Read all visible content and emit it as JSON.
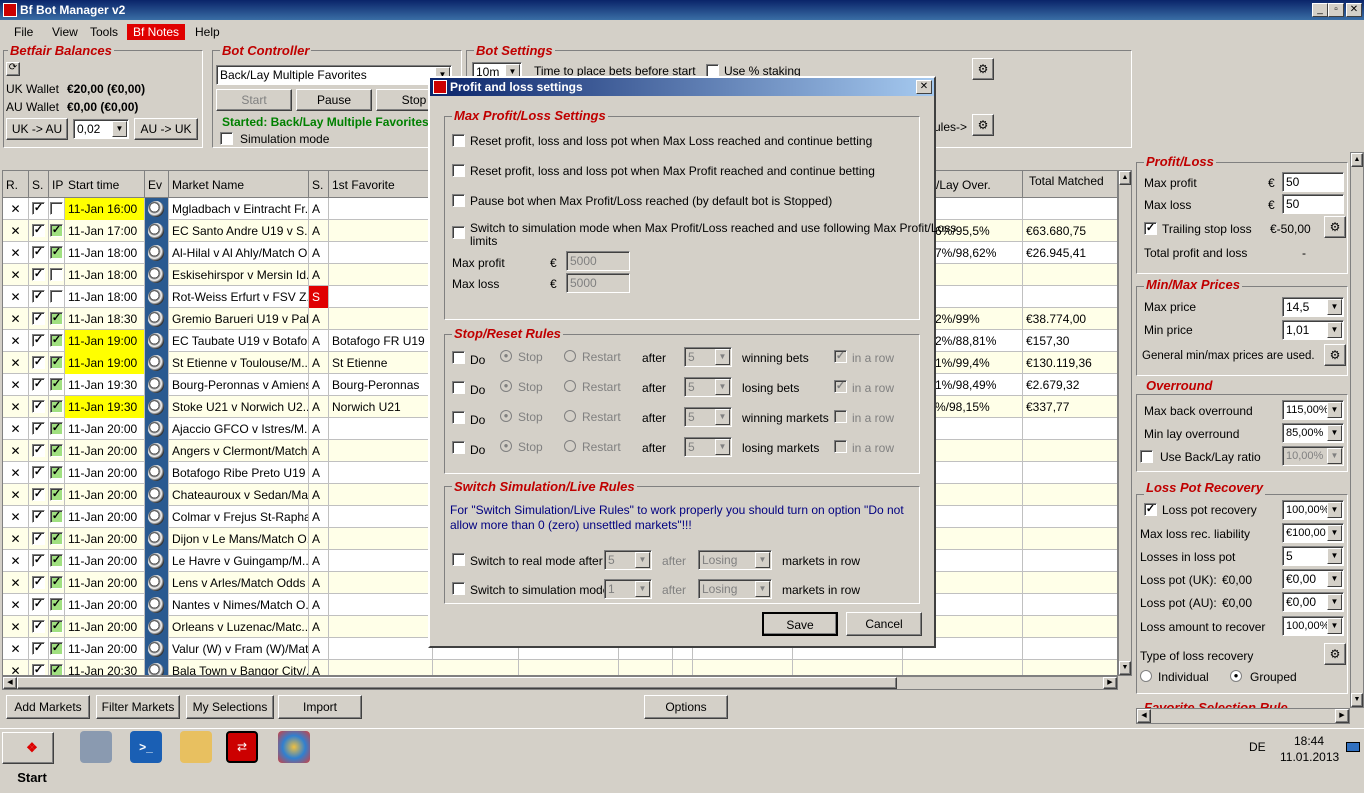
{
  "window": {
    "title": "Bf Bot Manager v2",
    "buttons": [
      "_",
      "▫",
      "✕"
    ]
  },
  "menu": [
    "File",
    "View",
    "Tools",
    "Bf Notes",
    "Help"
  ],
  "balances": {
    "title": "Betfair Balances",
    "uk_label": "UK Wallet",
    "uk_value": "€20,00 (€0,00)",
    "au_label": "AU Wallet",
    "au_value": "€0,00 (€0,00)",
    "uk_to_au": "UK -> AU",
    "amount": "0,02",
    "au_to_uk": "AU -> UK"
  },
  "controller": {
    "title": "Bot Controller",
    "strategy": "Back/Lay Multiple Favorites",
    "start": "Start",
    "pause": "Pause",
    "stop": "Stop",
    "status": "Started: Back/Lay Multiple Favorites",
    "sim_mode": "Simulation mode"
  },
  "settings": {
    "title": "Bot Settings",
    "time_value": "10m",
    "time_label": "Time to place bets before start",
    "use_staking": "Use % staking",
    "rules_label": "ules->"
  },
  "grid": {
    "headers": [
      "R.",
      "S.",
      "IP",
      "Start time",
      "Ev",
      "Market Name",
      "S.",
      "1st Favorite",
      "/Lay Over.",
      "Total Matched"
    ],
    "rows": [
      {
        "time": "11-Jan 16:00",
        "name": "Mgladbach v Eintracht Fr...",
        "s": "A",
        "fav": "",
        "over": "",
        "matched": "",
        "yellow": true,
        "red": false,
        "ip": false
      },
      {
        "time": "11-Jan 17:00",
        "name": "EC Santo Andre U19 v S...",
        "s": "A",
        "fav": "",
        "over": "6%/95,5%",
        "matched": "€63.680,75",
        "yellow": false,
        "red": false,
        "ip": true
      },
      {
        "time": "11-Jan 18:00",
        "name": "Al-Hilal v Al Ahly/Match O...",
        "s": "A",
        "fav": "",
        "over": "7%/98,62%",
        "matched": "€26.945,41",
        "yellow": false,
        "red": false,
        "ip": true
      },
      {
        "time": "11-Jan 18:00",
        "name": "Eskisehirspor v Mersin Id...",
        "s": "A",
        "fav": "",
        "over": "",
        "matched": "",
        "yellow": false,
        "red": false,
        "ip": false
      },
      {
        "time": "11-Jan 18:00",
        "name": "Rot-Weiss Erfurt v FSV Z...",
        "s": "S",
        "fav": "",
        "over": "",
        "matched": "",
        "yellow": false,
        "red": true,
        "ip": false
      },
      {
        "time": "11-Jan 18:30",
        "name": "Gremio Barueri U19 v Pal...",
        "s": "A",
        "fav": "",
        "over": "2%/99%",
        "matched": "€38.774,00",
        "yellow": false,
        "red": false,
        "ip": true
      },
      {
        "time": "11-Jan 19:00",
        "name": "EC Taubate U19 v Botafo...",
        "s": "A",
        "fav": "Botafogo FR U19",
        "over": "2%/88,81%",
        "matched": "€157,30",
        "yellow": true,
        "red": false,
        "ip": true
      },
      {
        "time": "11-Jan 19:00",
        "name": "St Etienne v Toulouse/M...",
        "s": "A",
        "fav": "St Etienne",
        "over": "1%/99,4%",
        "matched": "€130.119,36",
        "yellow": true,
        "red": false,
        "ip": true
      },
      {
        "time": "11-Jan 19:30",
        "name": "Bourg-Peronnas v Amiens...",
        "s": "A",
        "fav": "Bourg-Peronnas",
        "over": "1%/98,49%",
        "matched": "€2.679,32",
        "yellow": false,
        "red": false,
        "ip": true
      },
      {
        "time": "11-Jan 19:30",
        "name": "Stoke U21 v Norwich U2...",
        "s": "A",
        "fav": "Norwich U21",
        "over": "%/98,15%",
        "matched": "€337,77",
        "yellow": true,
        "red": false,
        "ip": true
      },
      {
        "time": "11-Jan 20:00",
        "name": "Ajaccio GFCO v Istres/M...",
        "s": "A",
        "fav": "",
        "over": "",
        "matched": "",
        "yellow": false,
        "red": false,
        "ip": true
      },
      {
        "time": "11-Jan 20:00",
        "name": "Angers v Clermont/Match...",
        "s": "A",
        "fav": "",
        "over": "",
        "matched": "",
        "yellow": false,
        "red": false,
        "ip": true
      },
      {
        "time": "11-Jan 20:00",
        "name": "Botafogo Ribe Preto U19 ...",
        "s": "A",
        "fav": "",
        "over": "",
        "matched": "",
        "yellow": false,
        "red": false,
        "ip": true
      },
      {
        "time": "11-Jan 20:00",
        "name": "Chateauroux v Sedan/Ma...",
        "s": "A",
        "fav": "",
        "over": "",
        "matched": "",
        "yellow": false,
        "red": false,
        "ip": true
      },
      {
        "time": "11-Jan 20:00",
        "name": "Colmar v Frejus St-Rapha...",
        "s": "A",
        "fav": "",
        "over": "",
        "matched": "",
        "yellow": false,
        "red": false,
        "ip": true
      },
      {
        "time": "11-Jan 20:00",
        "name": "Dijon v Le Mans/Match O...",
        "s": "A",
        "fav": "",
        "over": "",
        "matched": "",
        "yellow": false,
        "red": false,
        "ip": true
      },
      {
        "time": "11-Jan 20:00",
        "name": "Le Havre v Guingamp/M...",
        "s": "A",
        "fav": "",
        "over": "",
        "matched": "",
        "yellow": false,
        "red": false,
        "ip": true
      },
      {
        "time": "11-Jan 20:00",
        "name": "Lens v Arles/Match Odds",
        "s": "A",
        "fav": "",
        "over": "",
        "matched": "",
        "yellow": false,
        "red": false,
        "ip": true
      },
      {
        "time": "11-Jan 20:00",
        "name": "Nantes v Nimes/Match O...",
        "s": "A",
        "fav": "",
        "over": "",
        "matched": "",
        "yellow": false,
        "red": false,
        "ip": true
      },
      {
        "time": "11-Jan 20:00",
        "name": "Orleans v Luzenac/Matc...",
        "s": "A",
        "fav": "",
        "over": "",
        "matched": "",
        "yellow": false,
        "red": false,
        "ip": true
      },
      {
        "time": "11-Jan 20:00",
        "name": "Valur (W) v Fram (W)/Mat...",
        "s": "A",
        "fav": "",
        "over": "",
        "matched": "",
        "yellow": false,
        "red": false,
        "ip": true
      },
      {
        "time": "11-Jan 20:30",
        "name": "Bala Town v Bangor City/...",
        "s": "A",
        "fav": "",
        "over": "",
        "matched": "",
        "yellow": false,
        "red": false,
        "ip": true
      }
    ]
  },
  "bottom": {
    "add": "Add Markets",
    "filter": "Filter Markets",
    "my": "My Selections",
    "import": "Import",
    "options": "Options"
  },
  "right": {
    "pl_title": "Profit/Loss",
    "max_profit": "Max profit",
    "max_profit_val": "50",
    "max_loss": "Max loss",
    "max_loss_val": "50",
    "euro": "€",
    "trailing": "Trailing stop loss",
    "trailing_val": "€-50,00",
    "total": "Total profit and loss",
    "total_val": "-",
    "mm_title": "Min/Max Prices",
    "max_price": "Max price",
    "max_price_val": "14,5",
    "min_price": "Min price",
    "min_price_val": "1,01",
    "general": "General min/max prices are used.",
    "ov_title": "Overround",
    "max_back": "Max back overround",
    "max_back_val": "115,00%",
    "min_lay": "Min lay overround",
    "min_lay_val": "85,00%",
    "use_ratio": "Use Back/Lay ratio",
    "ratio_val": "10,00%",
    "lp_title": "Loss Pot Recovery",
    "lpr": "Loss pot recovery",
    "lpr_val": "100,00%",
    "max_liab": "Max loss rec. liability",
    "max_liab_val": "€100,00",
    "losses": "Losses in loss pot",
    "losses_val": "5",
    "lp_uk": "Loss pot (UK):",
    "lp_uk_v": "€0,00",
    "lp_uk_val": "€0,00",
    "lp_au": "Loss pot (AU):",
    "lp_au_v": "€0,00",
    "lp_au_val": "€0,00",
    "amount": "Loss amount to recover",
    "amount_val": "100,00%",
    "type": "Type of loss recovery",
    "individual": "Individual",
    "grouped": "Grouped",
    "next": "Favorite Selection Rule"
  },
  "dialog": {
    "title": "Profit and loss settings",
    "close": "✕",
    "g1": "Max Profit/Loss Settings",
    "c1": "Reset profit, loss and loss pot when Max Loss reached and continue betting",
    "c2": "Reset profit, loss and loss pot when Max Profit reached and continue betting",
    "c3": "Pause bot when Max Profit/Loss reached (by default bot is Stopped)",
    "c4a": "Switch to simulation mode when Max Profit/Loss reached and use following Max Profit/Loss",
    "c4b": "limits",
    "mp": "Max profit",
    "ml": "Max loss",
    "euro": "€",
    "mp_val": "5000",
    "ml_val": "5000",
    "g2": "Stop/Reset Rules",
    "rules": [
      {
        "do": "Do",
        "stop": "Stop",
        "restart": "Restart",
        "after": "after",
        "n": "5",
        "what": "winning bets",
        "inrow": "in a row",
        "inrow_checked": true
      },
      {
        "do": "Do",
        "stop": "Stop",
        "restart": "Restart",
        "after": "after",
        "n": "5",
        "what": "losing bets",
        "inrow": "in a row",
        "inrow_checked": true
      },
      {
        "do": "Do",
        "stop": "Stop",
        "restart": "Restart",
        "after": "after",
        "n": "5",
        "what": "winning markets",
        "inrow": "in a row",
        "inrow_checked": false
      },
      {
        "do": "Do",
        "stop": "Stop",
        "restart": "Restart",
        "after": "after",
        "n": "5",
        "what": "losing markets",
        "inrow": "in a row",
        "inrow_checked": false
      }
    ],
    "g3": "Switch Simulation/Live Rules",
    "note1": "For \"Switch Simulation/Live Rules\" to work properly you should turn on option \"Do not",
    "note2": "allow more than 0 (zero) unsettled markets\"!!!",
    "sw1": "Switch to real mode after",
    "sw1_n": "5",
    "sw1_after": "after",
    "sw1_sel": "Losing",
    "sw1_tail": "markets in row",
    "sw2": "Switch to simulation mode",
    "sw2_n": "1",
    "sw2_after": "after",
    "sw2_sel": "Losing",
    "sw2_tail": "markets in row",
    "save": "Save",
    "cancel": "Cancel"
  },
  "taskbar": {
    "start": "Start",
    "lang": "DE",
    "time": "18:44",
    "date": "11.01.2013"
  }
}
